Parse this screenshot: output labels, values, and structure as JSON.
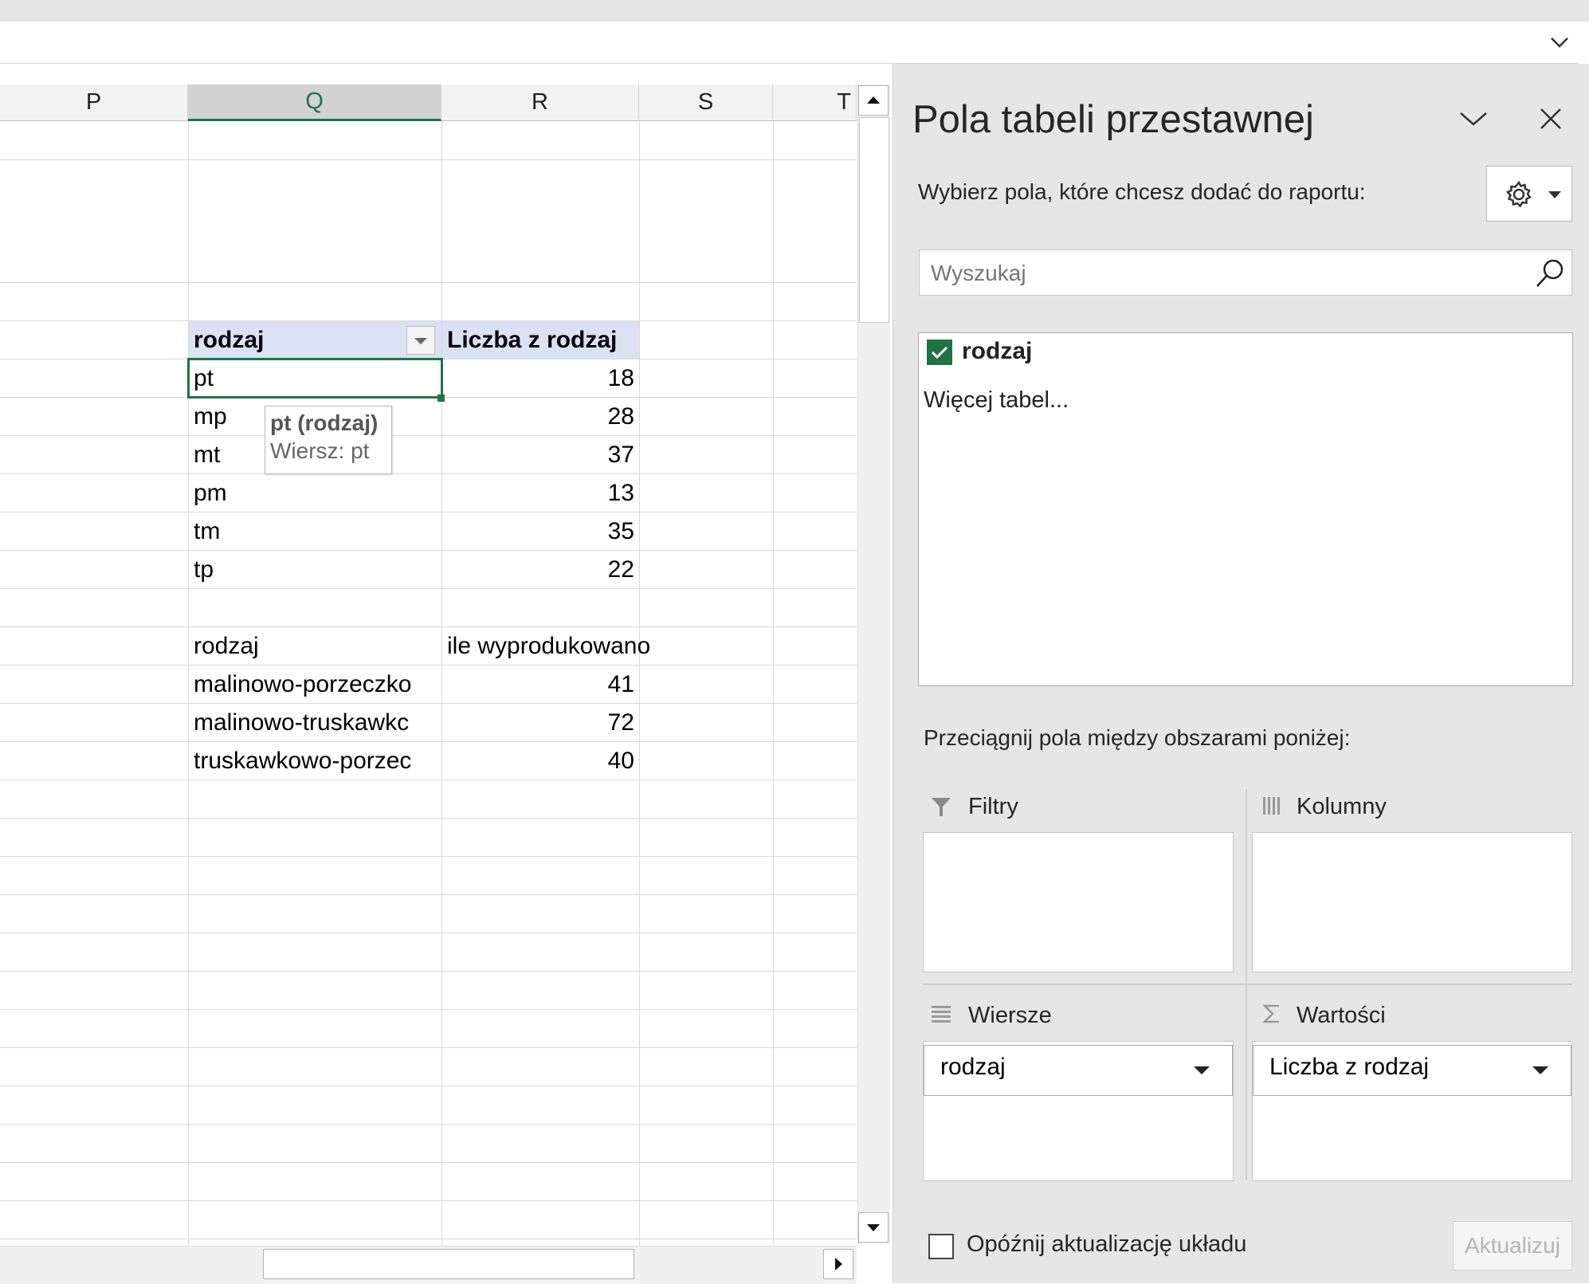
{
  "formula_bar": {
    "expand_icon": "chevron-down-icon"
  },
  "grid": {
    "columns": [
      "P",
      "Q",
      "R",
      "S",
      "T"
    ],
    "selected_column": "Q",
    "pivot": {
      "row_header": "rodzaj",
      "value_header": "Liczba z rodzaj",
      "rows": [
        {
          "label": "pt",
          "value": "18"
        },
        {
          "label": "mp",
          "value": "28"
        },
        {
          "label": "mt",
          "value": "37"
        },
        {
          "label": "pm",
          "value": "13"
        },
        {
          "label": "tm",
          "value": "35"
        },
        {
          "label": "tp",
          "value": "22"
        }
      ]
    },
    "tooltip": {
      "title": "pt (rodzaj)",
      "detail": "Wiersz: pt"
    },
    "table2": {
      "header_label": "rodzaj",
      "header_value": "ile wyprodukowano",
      "rows": [
        {
          "label": "malinowo-porzeczko",
          "value": "41"
        },
        {
          "label": "malinowo-truskawkc",
          "value": "72"
        },
        {
          "label": "truskawkowo-porzec",
          "value": "40"
        }
      ]
    }
  },
  "pane": {
    "title": "Pola tabeli przestawnej",
    "subtitle": "Wybierz pola, które chcesz dodać do raportu:",
    "search_placeholder": "Wyszukaj",
    "fields": [
      {
        "label": "rodzaj",
        "checked": true
      }
    ],
    "more_tables": "Więcej tabel...",
    "drag_hint": "Przeciągnij pola między obszarami poniżej:",
    "areas": {
      "filters": "Filtry",
      "columns": "Kolumny",
      "rows": "Wiersze",
      "values": "Wartości"
    },
    "rows_item": "rodzaj",
    "values_item": "Liczba z rodzaj",
    "defer_label": "Opóźnij aktualizację układu",
    "update_button": "Aktualizuj",
    "accent_color": "#217346"
  }
}
